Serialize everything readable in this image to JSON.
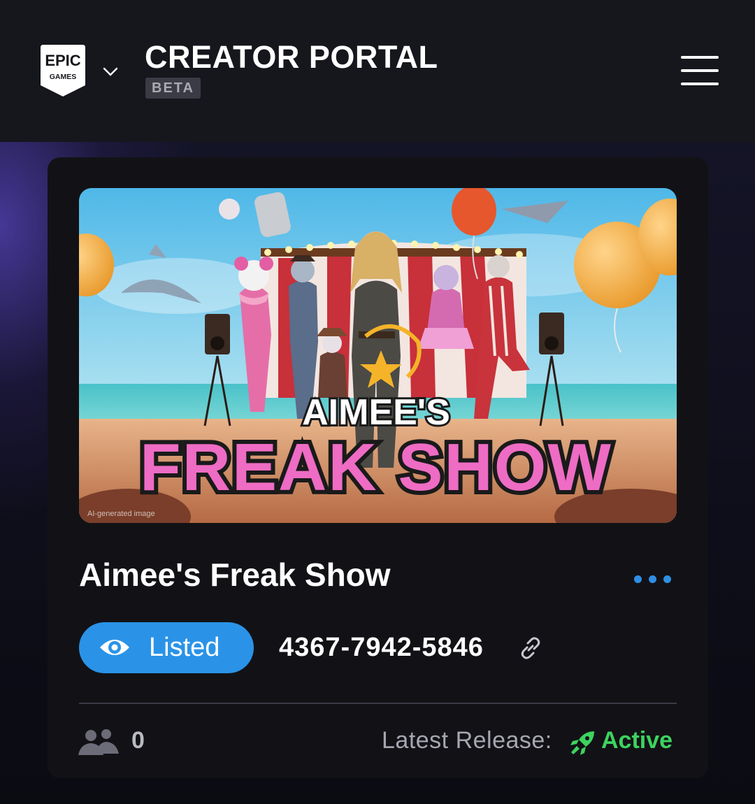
{
  "header": {
    "logo_text_top": "EPIC",
    "logo_text_bottom": "GAMES",
    "title": "CREATOR PORTAL",
    "badge": "BETA",
    "menu_icon": "hamburger-menu-icon",
    "chevron_icon": "chevron-down-icon"
  },
  "island": {
    "thumbnail_text_top": "AIMEE'S",
    "thumbnail_text_bottom": "FREAK SHOW",
    "thumbnail_watermark": "AI-generated image",
    "title": "Aimee's Freak Show",
    "status_label": "Listed",
    "code": "4367-7942-5846",
    "player_count": "0",
    "release_label": "Latest Release:",
    "release_status": "Active"
  },
  "colors": {
    "accent_blue": "#2a93e8",
    "active_green": "#3dd35f",
    "header_bg": "#16161d",
    "card_bg": "#121216"
  }
}
